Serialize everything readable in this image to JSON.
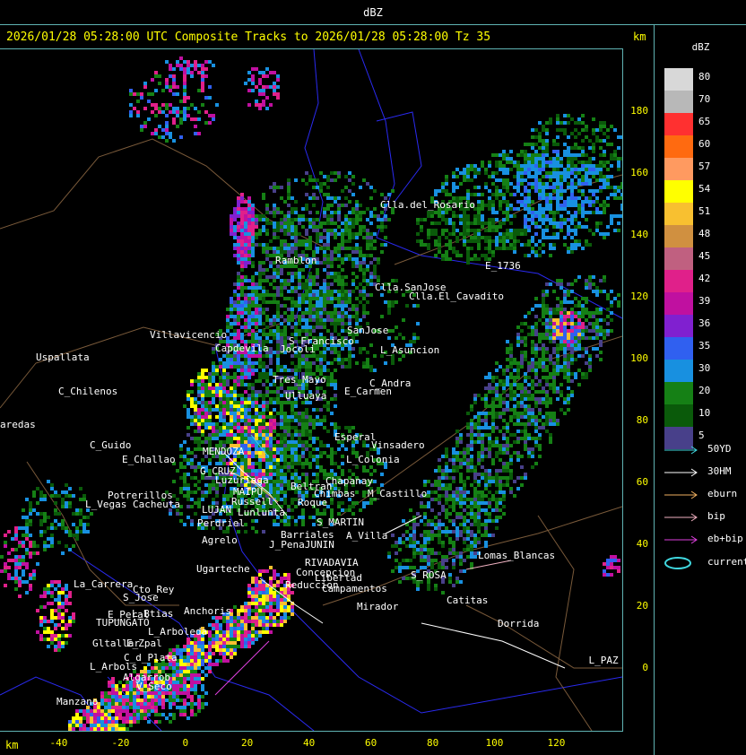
{
  "window_title": "dBZ",
  "subtitle": "2026/01/28 05:28:00 UTC Composite Tracks to 2026/01/28 05:28:00 Tz 35",
  "axis_unit": "km",
  "y_ticks": [
    "180",
    "160",
    "140",
    "120",
    "100",
    "80",
    "60",
    "40",
    "20",
    "0"
  ],
  "x_ticks": [
    "-40",
    "-20",
    "0",
    "20",
    "40",
    "60",
    "80",
    "100",
    "120"
  ],
  "legend": {
    "title": "dBZ",
    "levels": [
      {
        "label": "80",
        "color": "#d8d8d8"
      },
      {
        "label": "70",
        "color": "#b8b8b8"
      },
      {
        "label": "65",
        "color": "#ff3030"
      },
      {
        "label": "60",
        "color": "#ff6a10"
      },
      {
        "label": "57",
        "color": "#ff9a60"
      },
      {
        "label": "54",
        "color": "#ffff00"
      },
      {
        "label": "51",
        "color": "#f8c030"
      },
      {
        "label": "48",
        "color": "#d09040"
      },
      {
        "label": "45",
        "color": "#c06080"
      },
      {
        "label": "42",
        "color": "#e0208a"
      },
      {
        "label": "39",
        "color": "#c010a0"
      },
      {
        "label": "36",
        "color": "#8020d0"
      },
      {
        "label": "35",
        "color": "#3060f0"
      },
      {
        "label": "30",
        "color": "#1890e0"
      },
      {
        "label": "20",
        "color": "#158015"
      },
      {
        "label": "10",
        "color": "#0a5a0a"
      },
      {
        "label": "5",
        "color": "#48408a"
      }
    ],
    "tracks": [
      {
        "label": "50YD",
        "color": "#40d8e0"
      },
      {
        "label": "30HM",
        "color": "#ffffff"
      },
      {
        "label": "eburn",
        "color": "#f0b060"
      },
      {
        "label": "bip",
        "color": "#f0b0c0"
      },
      {
        "label": "eb+bip",
        "color": "#e040e0"
      },
      {
        "label": "current",
        "color": "#40d8e0"
      }
    ]
  },
  "places": [
    {
      "name": "Clla.del_Rosario"
    },
    {
      "name": "Ramblon"
    },
    {
      "name": "Clla.SanJose"
    },
    {
      "name": "Clla.El_Cavadito"
    },
    {
      "name": "E_1736"
    },
    {
      "name": "SanJose"
    },
    {
      "name": "L_Asuncion"
    },
    {
      "name": "S_Francisco"
    },
    {
      "name": "Jocoli"
    },
    {
      "name": "Villavicencio"
    },
    {
      "name": "Capdevila"
    },
    {
      "name": "Uspallata"
    },
    {
      "name": "C_Chilenos"
    },
    {
      "name": "Tres_Mayo"
    },
    {
      "name": "Ulluaya"
    },
    {
      "name": "E_Carmen"
    },
    {
      "name": "C_Andra"
    },
    {
      "name": "Esperal"
    },
    {
      "name": "C_Guido"
    },
    {
      "name": "E_Challao"
    },
    {
      "name": "MENDOZA"
    },
    {
      "name": "G_CRUZ"
    },
    {
      "name": "Luzuriaga"
    },
    {
      "name": "Vinsadero"
    },
    {
      "name": "L_Colonia"
    },
    {
      "name": "Beltran"
    },
    {
      "name": "Chimbas"
    },
    {
      "name": "Chapanay"
    },
    {
      "name": "M_Castillo"
    },
    {
      "name": "MAIPU"
    },
    {
      "name": "Russell"
    },
    {
      "name": "Potrerillos"
    },
    {
      "name": "L_Vegas"
    },
    {
      "name": "Cacheuta"
    },
    {
      "name": "LUJAN"
    },
    {
      "name": "Lunlunta"
    },
    {
      "name": "Perdriel"
    },
    {
      "name": "Roque"
    },
    {
      "name": "S_MARTIN"
    },
    {
      "name": "Agrelo"
    },
    {
      "name": "Barriales"
    },
    {
      "name": "A_Villa"
    },
    {
      "name": "Ugarteche"
    },
    {
      "name": "J_PenaJUNIN"
    },
    {
      "name": "RIVADAVIA"
    },
    {
      "name": "S_ROSA"
    },
    {
      "name": "Lomas_Blancas"
    },
    {
      "name": "La_Carrera"
    },
    {
      "name": "Cto_Rey"
    },
    {
      "name": "S_Jose"
    },
    {
      "name": "Libertad"
    },
    {
      "name": "Campamentos"
    },
    {
      "name": "Catitas"
    },
    {
      "name": "E_Peral"
    },
    {
      "name": "TUPUNGATO"
    },
    {
      "name": "Anchoris"
    },
    {
      "name": "Mirador"
    },
    {
      "name": "L_Btias"
    },
    {
      "name": "Dorrida"
    },
    {
      "name": "L_Arboleda"
    },
    {
      "name": "Gltallar"
    },
    {
      "name": "E_Zpal"
    },
    {
      "name": "L_Arbols"
    },
    {
      "name": "C_d_Plata"
    },
    {
      "name": "Algarrob"
    },
    {
      "name": "V_Seco"
    },
    {
      "name": "Manzano"
    },
    {
      "name": "L_PAZ"
    },
    {
      "name": "aredas"
    },
    {
      "name": "Concepcion"
    },
    {
      "name": "Reduccion"
    }
  ]
}
